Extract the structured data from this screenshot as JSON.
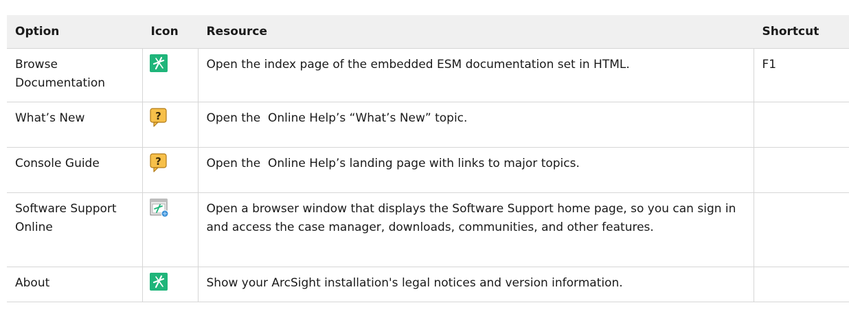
{
  "table": {
    "headers": {
      "option": "Option",
      "icon": "Icon",
      "resource": "Resource",
      "shortcut": "Shortcut"
    },
    "rows": [
      {
        "option": "Browse Documentation",
        "icon": "arcsight-logo-icon",
        "resource": "Open the index page of the embedded ESM documentation set in HTML.",
        "shortcut": "F1"
      },
      {
        "option": "What’s New",
        "icon": "help-question-icon",
        "resource": "Open the  Online Help’s “What’s New” topic.",
        "shortcut": ""
      },
      {
        "option": "Console Guide",
        "icon": "help-question-icon",
        "resource": "Open the  Online Help’s landing page with links to major topics.",
        "shortcut": ""
      },
      {
        "option": "Software Support Online",
        "icon": "support-browser-icon",
        "resource": "Open a browser window that displays the Software Support home page, so you can sign in and access the case manager, downloads, communities, and other features.",
        "shortcut": ""
      },
      {
        "option": "About",
        "icon": "arcsight-logo-icon",
        "resource": "Show your ArcSight installation's legal notices and version information.",
        "shortcut": ""
      }
    ]
  },
  "colors": {
    "header_bg": "#f0f0f0",
    "border": "#d6d6d6",
    "arcsight_green": "#1fb57a",
    "help_orange": "#f5b335"
  }
}
